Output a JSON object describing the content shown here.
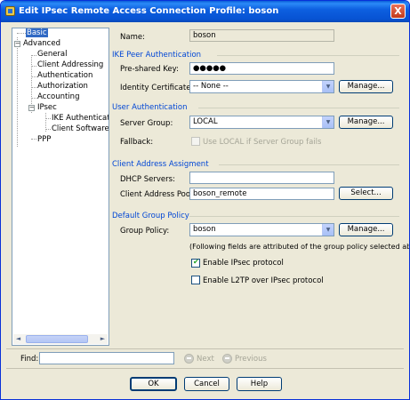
{
  "window": {
    "title": "Edit IPsec Remote Access Connection Profile: boson",
    "close_label": "X"
  },
  "tree": {
    "items": [
      {
        "label": "Basic",
        "selected": true
      },
      {
        "label": "Advanced",
        "toggle": "−"
      },
      {
        "label": "General"
      },
      {
        "label": "Client Addressing"
      },
      {
        "label": "Authentication"
      },
      {
        "label": "Authorization"
      },
      {
        "label": "Accounting"
      },
      {
        "label": "IPsec",
        "toggle": "−"
      },
      {
        "label": "IKE Authentication"
      },
      {
        "label": "Client Software Upd"
      },
      {
        "label": "PPP"
      }
    ],
    "scroll_left": "◄",
    "scroll_right": "►"
  },
  "form": {
    "name_label": "Name:",
    "name_value": "boson",
    "ike": {
      "section": "IKE Peer Authentication",
      "psk_label": "Pre-shared Key:",
      "psk_value": "●●●●●",
      "cert_label": "Identity Certificate:",
      "cert_value": "-- None --",
      "manage_label": "Manage..."
    },
    "user_auth": {
      "section": "User Authentication",
      "server_group_label": "Server Group:",
      "server_group_value": "LOCAL",
      "manage_label": "Manage...",
      "fallback_label": "Fallback:",
      "fallback_option": "Use LOCAL if Server Group fails"
    },
    "client_addr": {
      "section": "Client Address Assigment",
      "dhcp_label": "DHCP Servers:",
      "dhcp_value": "",
      "pools_label": "Client Address Pools:",
      "pools_value": "boson_remote",
      "select_label": "Select..."
    },
    "group_policy": {
      "section": "Default Group Policy",
      "policy_label": "Group Policy:",
      "policy_value": "boson",
      "manage_label": "Manage...",
      "note": "(Following fields are attributed of the group policy selected above.)",
      "ipsec_label": "Enable IPsec protocol",
      "ipsec_checked": true,
      "l2tp_label": "Enable L2TP over IPsec protocol",
      "l2tp_checked": false
    }
  },
  "find": {
    "label": "Find:",
    "value": "",
    "next_label": "Next",
    "previous_label": "Previous"
  },
  "buttons": {
    "ok": "OK",
    "cancel": "Cancel",
    "help": "Help"
  },
  "icons": {
    "dropdown": "▼"
  }
}
